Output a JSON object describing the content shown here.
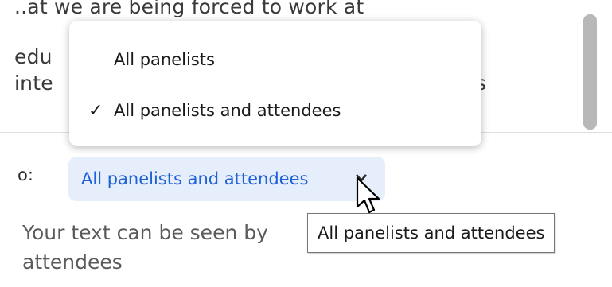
{
  "chat": {
    "lines": [
      "..at we are being forced to work at",
      "edu",
      "inte"
    ],
    "line3_tail": "s"
  },
  "compose": {
    "to_label": "o:",
    "recipient": "All panelists and attendees",
    "info_text_line1": "Your text can be seen by",
    "info_text_line2": "attendees"
  },
  "dropdown": {
    "items": [
      {
        "label": "All panelists",
        "checked": false
      },
      {
        "label": "All panelists and attendees",
        "checked": true
      }
    ],
    "check_glyph": "✓"
  },
  "tooltip": {
    "text": "All panelists and attendees"
  },
  "colors": {
    "accent": "#1f61d6",
    "pill_bg": "#e6eefc"
  },
  "icons": {
    "chevron": "chevron-down-icon",
    "check": "checkmark-icon",
    "cursor": "mouse-pointer-icon"
  }
}
